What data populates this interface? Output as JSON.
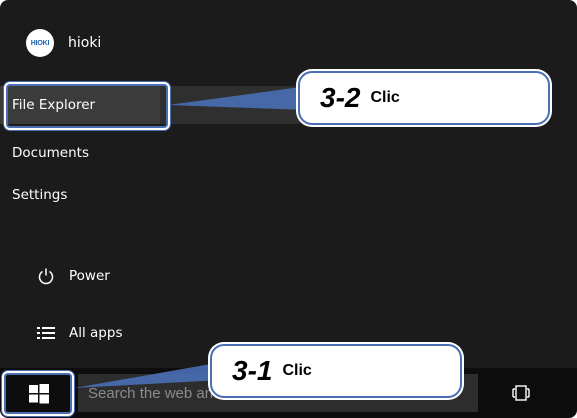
{
  "user": {
    "name": "hioki",
    "avatar_text": "HIOKI"
  },
  "menu": {
    "file_explorer": "File Explorer",
    "documents": "Documents",
    "settings": "Settings",
    "power": "Power",
    "all_apps": "All apps"
  },
  "taskbar": {
    "search_placeholder": "Search the web and Windows"
  },
  "callouts": {
    "step_2": {
      "number": "3-2",
      "text": "Clic"
    },
    "step_1": {
      "number": "3-1",
      "text": "Clic"
    }
  },
  "colors": {
    "accent": "#4a6fb5",
    "menu_bg": "#1b1b1b",
    "taskbar_bg": "#0d0d0d"
  }
}
